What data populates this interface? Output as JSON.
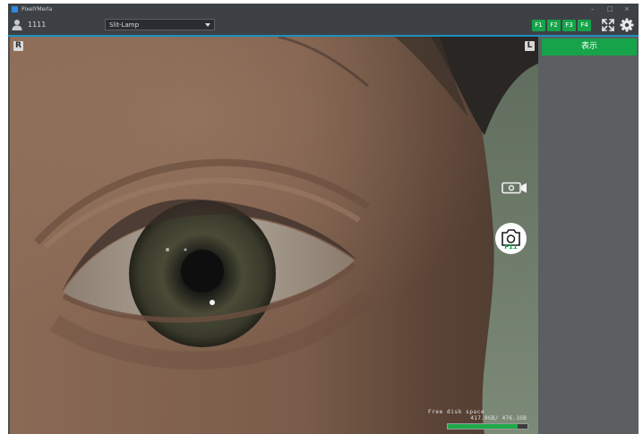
{
  "window": {
    "title": "PixelYMerla",
    "minimize": "–",
    "maximize": "□",
    "close": "×"
  },
  "toolbar": {
    "user_id": "1111",
    "mode": "Slit-Lamp",
    "fkeys": [
      "F1",
      "F2",
      "F3",
      "F4"
    ],
    "icons": [
      "user-icon",
      "fullscreen-icon",
      "gear-icon"
    ]
  },
  "viewport": {
    "right_tag": "R",
    "left_tag": "L",
    "capture_hotkey": "F11",
    "icons": [
      "video-camera-icon",
      "camera-icon"
    ]
  },
  "side_panel": {
    "display_button": "表示"
  },
  "disk": {
    "label": "Free disk space",
    "value": "417.0GB/ 476.1GB",
    "free_fraction": 0.876
  },
  "colors": {
    "accent_green": "#16a34a",
    "toolbar_bg": "#3d4145",
    "panel_bg": "#5b5f62",
    "divider_blue": "#1f8fbe"
  }
}
